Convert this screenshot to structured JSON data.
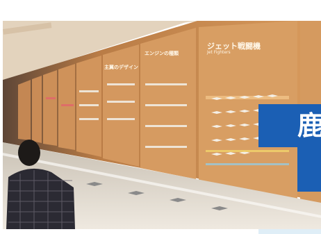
{
  "scene": {
    "description_colors": {
      "wall": "#c98a4f",
      "panel": "#d19659",
      "banner": "#1b5fb4",
      "case": "#e9e4dc"
    }
  },
  "panels": {
    "jet_title": "ジェット戦闘機",
    "jet_subtitle": "Jet Fighters",
    "engine_title": "エンジンの種類",
    "design_title": "主翼のデザイン"
  },
  "banner": {
    "char": "鹿"
  }
}
